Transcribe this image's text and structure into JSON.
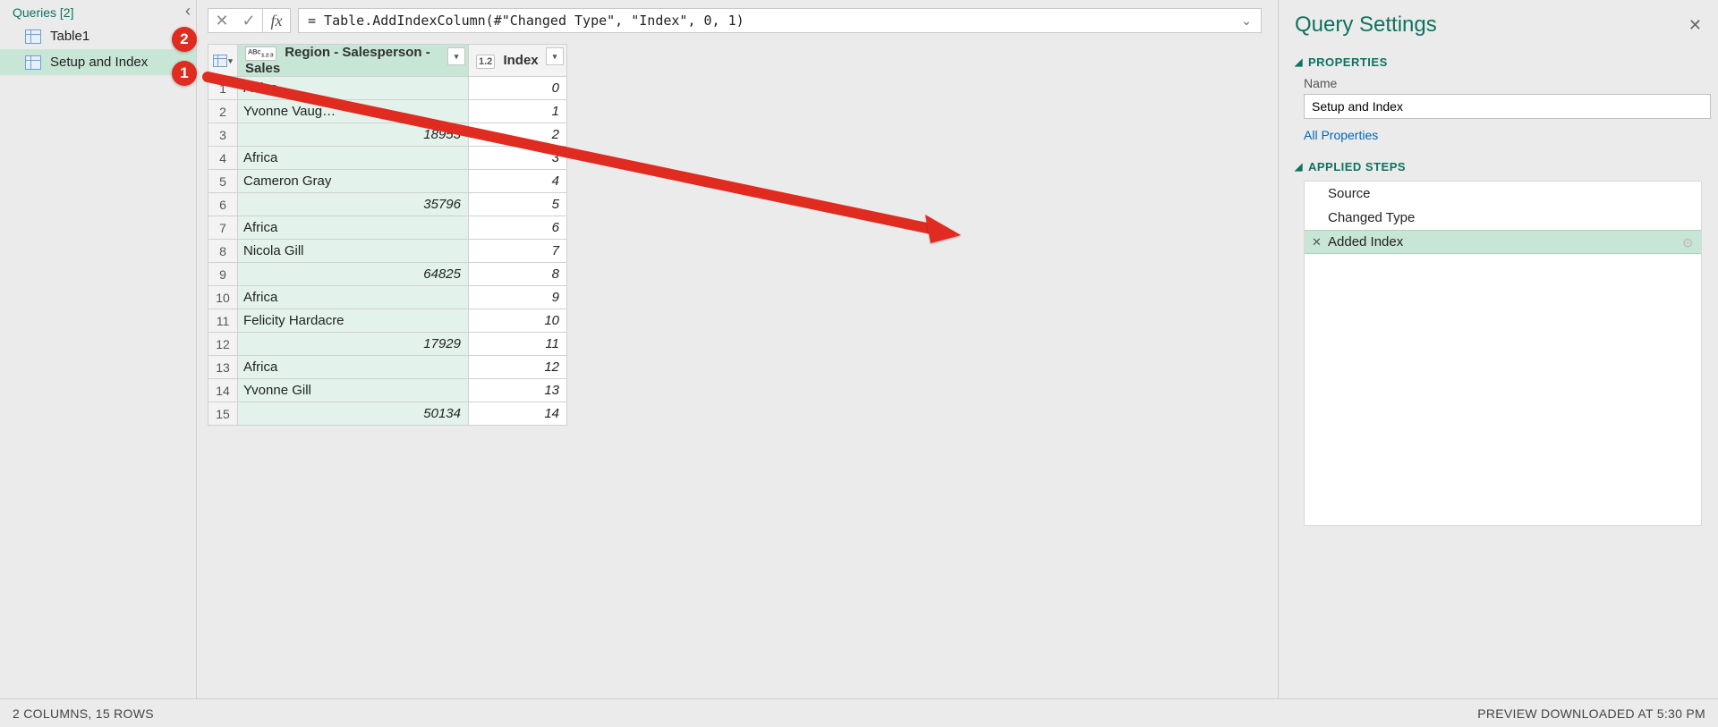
{
  "queries": {
    "header": "Queries [2]",
    "items": [
      {
        "label": "Table1",
        "selected": false
      },
      {
        "label": "Setup and Index",
        "selected": true
      }
    ]
  },
  "formula_bar": {
    "cancel_icon": "✕",
    "commit_icon": "✓",
    "fx_label": "fx",
    "formula": "= Table.AddIndexColumn(#\"Changed Type\", \"Index\", 0, 1)"
  },
  "table": {
    "col1_type": "ᴬᴮᶜ₁₂₃",
    "col1_header": "Region - Salesperson - Sales",
    "col2_type": "1.2",
    "col2_header": "Index",
    "rows": [
      {
        "n": "1",
        "region": "Africa",
        "numeric": false,
        "index": "0"
      },
      {
        "n": "2",
        "region": "Yvonne Vaug…",
        "numeric": false,
        "index": "1"
      },
      {
        "n": "3",
        "region": "18953",
        "numeric": true,
        "index": "2"
      },
      {
        "n": "4",
        "region": "Africa",
        "numeric": false,
        "index": "3"
      },
      {
        "n": "5",
        "region": "Cameron Gray",
        "numeric": false,
        "index": "4"
      },
      {
        "n": "6",
        "region": "35796",
        "numeric": true,
        "index": "5"
      },
      {
        "n": "7",
        "region": "Africa",
        "numeric": false,
        "index": "6"
      },
      {
        "n": "8",
        "region": "Nicola Gill",
        "numeric": false,
        "index": "7"
      },
      {
        "n": "9",
        "region": "64825",
        "numeric": true,
        "index": "8"
      },
      {
        "n": "10",
        "region": "Africa",
        "numeric": false,
        "index": "9"
      },
      {
        "n": "11",
        "region": "Felicity Hardacre",
        "numeric": false,
        "index": "10"
      },
      {
        "n": "12",
        "region": "17929",
        "numeric": true,
        "index": "11"
      },
      {
        "n": "13",
        "region": "Africa",
        "numeric": false,
        "index": "12"
      },
      {
        "n": "14",
        "region": "Yvonne Gill",
        "numeric": false,
        "index": "13"
      },
      {
        "n": "15",
        "region": "50134",
        "numeric": true,
        "index": "14"
      }
    ]
  },
  "settings": {
    "title": "Query Settings",
    "properties_header": "PROPERTIES",
    "name_label": "Name",
    "name_value": "Setup and Index",
    "all_properties": "All Properties",
    "steps_header": "APPLIED STEPS",
    "steps": [
      {
        "label": "Source",
        "active": false,
        "gear": false
      },
      {
        "label": "Changed Type",
        "active": false,
        "gear": false
      },
      {
        "label": "Added Index",
        "active": true,
        "gear": true
      }
    ]
  },
  "status": {
    "left": "2 COLUMNS, 15 ROWS",
    "right": "PREVIEW DOWNLOADED AT 5:30 PM"
  },
  "annotations": {
    "badge1": "1",
    "badge2": "2"
  }
}
